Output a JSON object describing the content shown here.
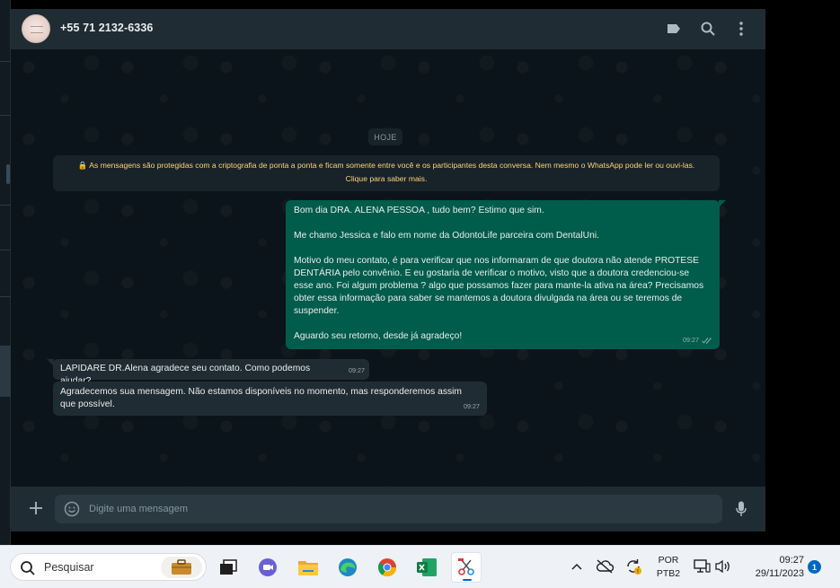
{
  "header": {
    "contact_name": "+55 71 2132-6336",
    "icons": [
      "label-icon",
      "search-icon",
      "menu-dots-icon"
    ]
  },
  "chat": {
    "day_label": "HOJE",
    "encryption_notice": "🔒 As mensagens são protegidas com a criptografia de ponta a ponta e ficam somente entre você e os participantes desta conversa. Nem mesmo o WhatsApp pode ler ou ouvi-las. Clique para saber mais.",
    "messages": [
      {
        "direction": "outgoing",
        "paragraphs": [
          "Bom dia DRA. ALENA PESSOA , tudo bem? Estimo que sim.",
          "Me chamo Jessica e falo em nome da OdontoLife parceira com DentalUni.",
          "Motivo do meu contato, é para verificar que nos informaram de que doutora não atende PROTESE DENTÁRIA pelo convênio. E eu gostaria de verificar o motivo, visto que a doutora credenciou-se esse ano. Foi algum problema ? algo que possamos fazer para mante-la ativa na área? Precisamos obter essa informação para saber se mantemos a doutora divulgada na área ou se teremos de suspender.",
          "Aguardo seu retorno, desde já agradeço!"
        ],
        "time": "09:27",
        "status": "read"
      },
      {
        "direction": "incoming",
        "text": "LAPIDARE DR.Alena agradece seu contato. Como podemos ajudar?",
        "time": "09:27"
      },
      {
        "direction": "incoming",
        "text": "Agradecemos sua mensagem. Não estamos disponíveis no momento, mas responderemos assim que possível.",
        "time": "09:27"
      }
    ]
  },
  "composer": {
    "placeholder": "Digite uma mensagem"
  },
  "taskbar": {
    "search_label": "Pesquisar",
    "language_line1": "POR",
    "language_line2": "PTB2",
    "time": "09:27",
    "date": "29/11/2023",
    "notification_count": "1"
  },
  "colors": {
    "outgoing_bubble": "#005c4b",
    "incoming_bubble": "#202c33",
    "encryption_text": "#ffd279",
    "accent": "#0067c0"
  }
}
